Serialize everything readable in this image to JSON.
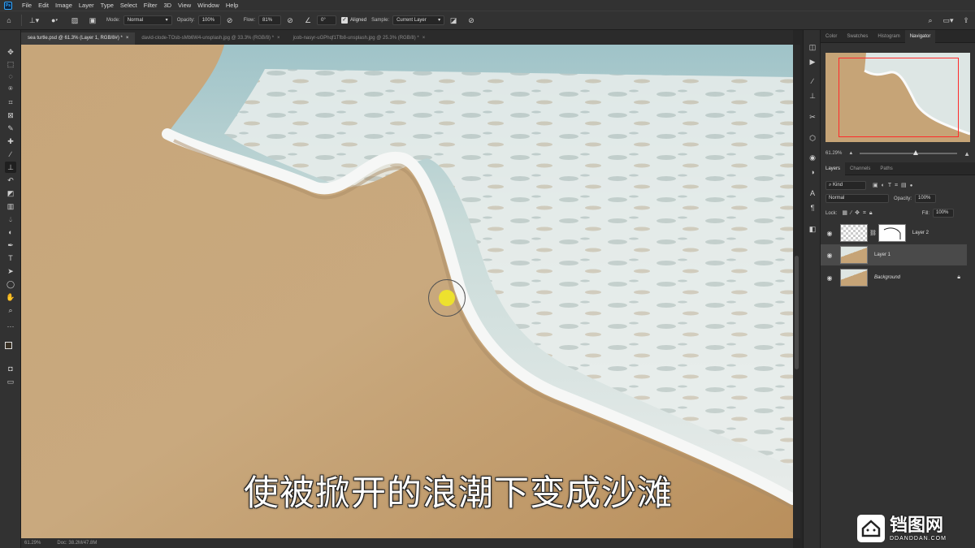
{
  "app": {
    "name": "Adobe Photoshop",
    "logo_text": "Ps"
  },
  "menu": [
    "File",
    "Edit",
    "Image",
    "Layer",
    "Type",
    "Select",
    "Filter",
    "3D",
    "View",
    "Window",
    "Help"
  ],
  "options_bar": {
    "mode_label": "Mode:",
    "mode_value": "Normal",
    "opacity_label": "Opacity:",
    "opacity_value": "100%",
    "flow_label": "Flow:",
    "flow_value": "81%",
    "angle_value": "0°",
    "aligned_label": "Aligned",
    "sample_label": "Sample:",
    "sample_value": "Current Layer"
  },
  "tabs": [
    {
      "label": "sea turtle.psd @ 61.3% (Layer 1, RGB/8#) *",
      "active": true
    },
    {
      "label": "david-clode-TOsb-sMb6W4-unsplash.jpg @ 33.3% (RGB/8) *",
      "active": false
    },
    {
      "label": "jcob-nasyr-uGPhqf1Tfb8-unsplash.jpg @ 25.3% (RGB/8) *",
      "active": false
    }
  ],
  "status_bar": {
    "zoom": "61.29%",
    "doc": "Doc: 38.2M/47.8M"
  },
  "subtitle": "使被掀开的浪潮下变成沙滩",
  "panels": {
    "top_tabs": [
      "Color",
      "Swatches",
      "Histogram",
      "Navigator"
    ],
    "navigator_zoom": "61.29%",
    "layer_tabs": [
      "Layers",
      "Channels",
      "Paths"
    ],
    "filter_kind": "Kind",
    "blend_mode": "Normal",
    "opacity_label": "Opacity:",
    "opacity_value": "100%",
    "lock_label": "Lock:",
    "fill_label": "Fill:",
    "fill_value": "100%",
    "layers": [
      {
        "name": "Layer 2",
        "active": false,
        "type": "transparent-with-mask"
      },
      {
        "name": "Layer 1",
        "active": true,
        "type": "image"
      },
      {
        "name": "Background",
        "active": false,
        "type": "image-locked"
      }
    ]
  },
  "watermark": {
    "main": "铛图网",
    "sub": "DDANDDAN.COM"
  },
  "colors": {
    "brush_dot": "#ede12e",
    "nav_box": "#ff2b2b",
    "sand": "#c9a97d",
    "ui_bg": "#323232"
  }
}
